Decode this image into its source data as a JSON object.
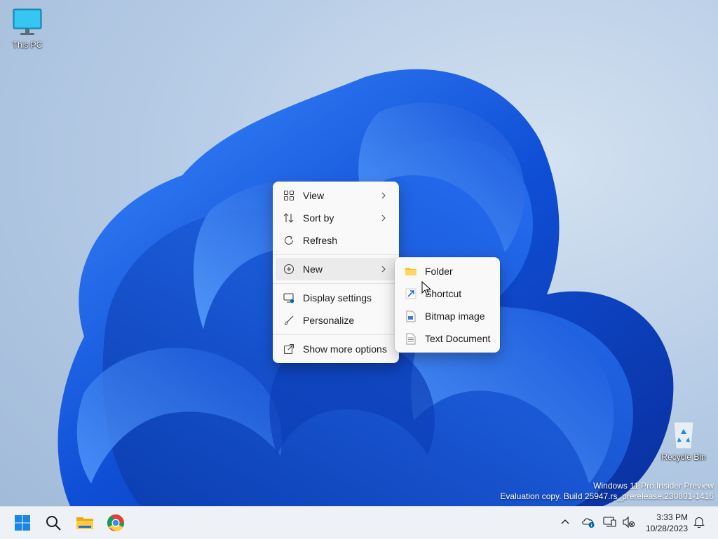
{
  "desktop": {
    "icons": [
      {
        "label": "This PC"
      },
      {
        "label": "Recycle Bin"
      }
    ],
    "watermark": {
      "line1": "Windows 11 Pro Insider Preview",
      "line2": "Evaluation copy. Build 25947.rs_prerelease.230801-1416"
    }
  },
  "context_menu": {
    "items": [
      {
        "label": "View",
        "icon": "grid-icon",
        "submenu": true
      },
      {
        "label": "Sort by",
        "icon": "sort-icon",
        "submenu": true
      },
      {
        "label": "Refresh",
        "icon": "refresh-icon",
        "submenu": false
      },
      {
        "label": "New",
        "icon": "plus-circle-icon",
        "submenu": true,
        "active": true
      },
      {
        "label": "Display settings",
        "icon": "display-settings-icon",
        "submenu": false
      },
      {
        "label": "Personalize",
        "icon": "brush-icon",
        "submenu": false
      },
      {
        "label": "Show more options",
        "icon": "expand-icon",
        "submenu": false
      }
    ]
  },
  "new_submenu": {
    "items": [
      {
        "label": "Folder",
        "icon": "folder-icon"
      },
      {
        "label": "Shortcut",
        "icon": "shortcut-icon"
      },
      {
        "label": "Bitmap image",
        "icon": "bitmap-icon"
      },
      {
        "label": "Text Document",
        "icon": "text-document-icon"
      }
    ]
  },
  "taskbar": {
    "apps": [
      "start-icon",
      "search-icon",
      "file-explorer-icon",
      "chrome-icon"
    ],
    "clock": {
      "time": "3:33 PM",
      "date": "10/28/2023"
    }
  },
  "colors": {
    "accent": "#0067c0",
    "wallpaper_bloom": "#1a5fe0",
    "menu_bg": "#f9f9f9"
  }
}
